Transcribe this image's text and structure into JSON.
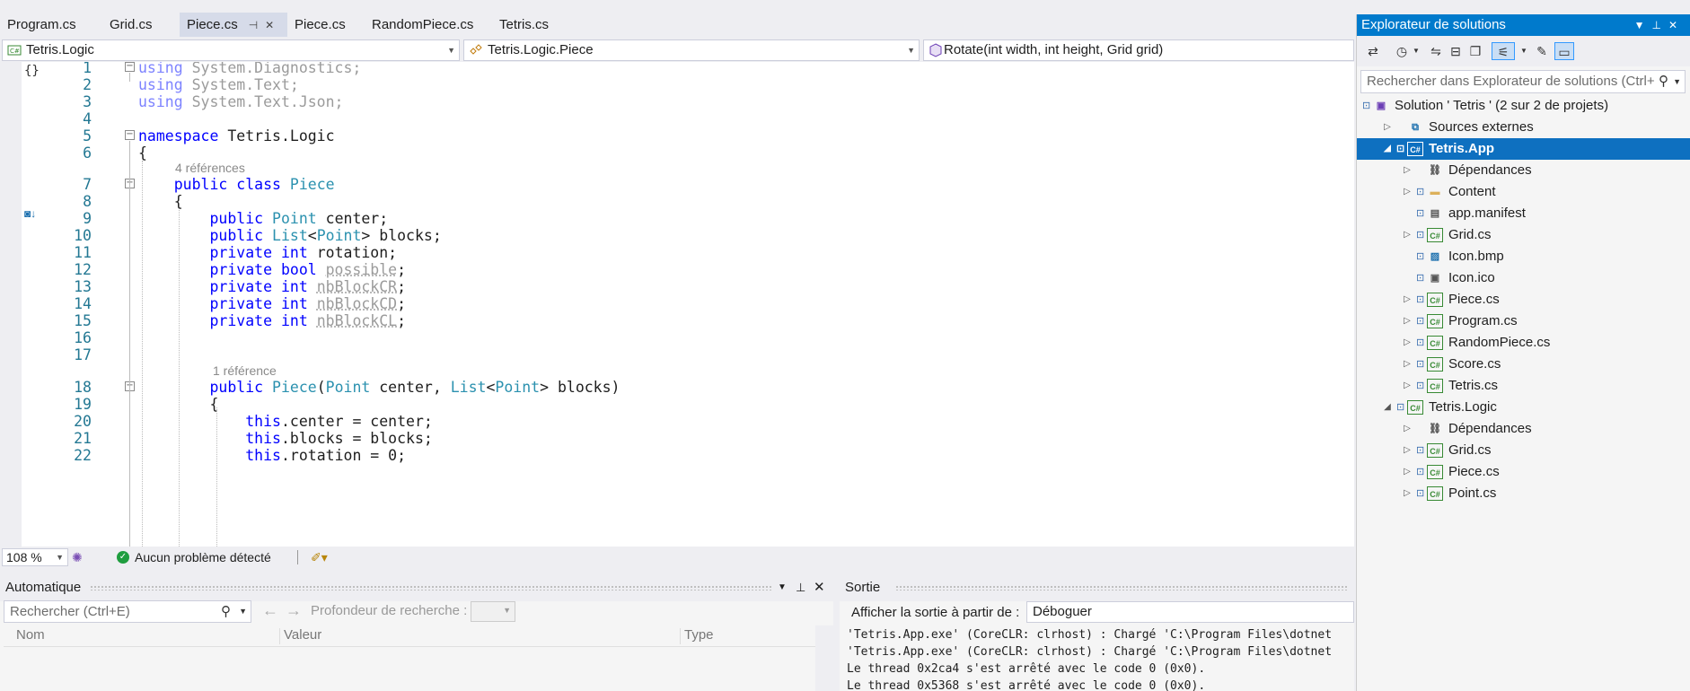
{
  "tabs": [
    {
      "label": "Program.cs",
      "active": false
    },
    {
      "label": "Grid.cs",
      "active": false
    },
    {
      "label": "Piece.cs",
      "active": true
    },
    {
      "label": "Piece.cs",
      "active": false
    },
    {
      "label": "RandomPiece.cs",
      "active": false
    },
    {
      "label": "Tetris.cs",
      "active": false
    }
  ],
  "navbar": {
    "project": "Tetris.Logic",
    "type": "Tetris.Logic.Piece",
    "member": "Rotate(int width, int height, Grid grid)"
  },
  "editor": {
    "lines": [
      {
        "n": "1",
        "tokens": [
          [
            "kw-dim",
            "using "
          ],
          [
            "dim",
            "System.Diagnostics;"
          ]
        ]
      },
      {
        "n": "2",
        "tokens": [
          [
            "kw-dim",
            "using "
          ],
          [
            "dim",
            "System.Text;"
          ]
        ]
      },
      {
        "n": "3",
        "tokens": [
          [
            "kw-dim",
            "using "
          ],
          [
            "dim",
            "System.Text.Json;"
          ]
        ]
      },
      {
        "n": "4",
        "tokens": []
      },
      {
        "n": "5",
        "tokens": [
          [
            "kw",
            "namespace "
          ],
          [
            "",
            "Tetris.Logic"
          ]
        ]
      },
      {
        "n": "6",
        "tokens": [
          [
            "",
            "{"
          ]
        ]
      },
      {
        "n": "7",
        "tokens": [
          [
            "",
            "    "
          ],
          [
            "kw",
            "public class "
          ],
          [
            "ty",
            "Piece"
          ]
        ]
      },
      {
        "n": "8",
        "tokens": [
          [
            "",
            "    {"
          ]
        ]
      },
      {
        "n": "9",
        "tokens": [
          [
            "",
            "        "
          ],
          [
            "kw",
            "public "
          ],
          [
            "ty",
            "Point"
          ],
          [
            "",
            " center;"
          ]
        ]
      },
      {
        "n": "10",
        "tokens": [
          [
            "",
            "        "
          ],
          [
            "kw",
            "public "
          ],
          [
            "ty",
            "List"
          ],
          [
            "",
            "<"
          ],
          [
            "ty",
            "Point"
          ],
          [
            "",
            "> blocks;"
          ]
        ]
      },
      {
        "n": "11",
        "tokens": [
          [
            "",
            "        "
          ],
          [
            "kw",
            "private int "
          ],
          [
            "",
            "rotation;"
          ]
        ]
      },
      {
        "n": "12",
        "tokens": [
          [
            "",
            "        "
          ],
          [
            "kw",
            "private bool "
          ],
          [
            "gru",
            "possible"
          ],
          [
            "",
            ";"
          ]
        ]
      },
      {
        "n": "13",
        "tokens": [
          [
            "",
            "        "
          ],
          [
            "kw",
            "private int "
          ],
          [
            "gru",
            "nbBlockCR"
          ],
          [
            "",
            ";"
          ]
        ]
      },
      {
        "n": "14",
        "tokens": [
          [
            "",
            "        "
          ],
          [
            "kw",
            "private int "
          ],
          [
            "gru",
            "nbBlockCD"
          ],
          [
            "",
            ";"
          ]
        ]
      },
      {
        "n": "15",
        "tokens": [
          [
            "",
            "        "
          ],
          [
            "kw",
            "private int "
          ],
          [
            "gru",
            "nbBlockCL"
          ],
          [
            "",
            ";"
          ]
        ]
      },
      {
        "n": "16",
        "tokens": []
      },
      {
        "n": "17",
        "tokens": []
      },
      {
        "n": "18",
        "tokens": [
          [
            "",
            "        "
          ],
          [
            "kw",
            "public "
          ],
          [
            "ty",
            "Piece"
          ],
          [
            "",
            "("
          ],
          [
            "ty",
            "Point"
          ],
          [
            "",
            " center, "
          ],
          [
            "ty",
            "List"
          ],
          [
            "",
            "<"
          ],
          [
            "ty",
            "Point"
          ],
          [
            "",
            "> blocks)"
          ]
        ]
      },
      {
        "n": "19",
        "tokens": [
          [
            "",
            "        {"
          ]
        ]
      },
      {
        "n": "20",
        "tokens": [
          [
            "",
            "            "
          ],
          [
            "kw",
            "this"
          ],
          [
            "",
            ".center = center;"
          ]
        ]
      },
      {
        "n": "21",
        "tokens": [
          [
            "",
            "            "
          ],
          [
            "kw",
            "this"
          ],
          [
            "",
            ".blocks = blocks;"
          ]
        ]
      },
      {
        "n": "22",
        "tokens": [
          [
            "",
            "            "
          ],
          [
            "kw",
            "this"
          ],
          [
            "",
            ".rotation = 0;"
          ]
        ]
      }
    ],
    "refs": [
      {
        "text": "4 références"
      },
      {
        "text": "1 référence"
      }
    ]
  },
  "status": {
    "zoom": "108 %",
    "problems": "Aucun problème détecté"
  },
  "auto_panel": {
    "title": "Automatique",
    "search_placeholder": "Rechercher (Ctrl+E)",
    "depth_label": "Profondeur de recherche :",
    "columns": [
      "Nom",
      "Valeur",
      "Type"
    ]
  },
  "output_panel": {
    "title": "Sortie",
    "source_label": "Afficher la sortie à partir de :",
    "source_value": "Déboguer",
    "lines": [
      "'Tetris.App.exe' (CoreCLR: clrhost) : Chargé 'C:\\Program Files\\dotnet",
      "'Tetris.App.exe' (CoreCLR: clrhost) : Chargé 'C:\\Program Files\\dotnet",
      "Le thread 0x2ca4 s'est arrêté avec le code 0 (0x0).",
      "Le thread 0x5368 s'est arrêté avec le code 0 (0x0)."
    ]
  },
  "solution_explorer": {
    "title": "Explorateur de solutions",
    "search_placeholder": "Rechercher dans Explorateur de solutions (Ctrl+",
    "items": [
      {
        "label": "Solution ' Tetris ' (2 sur 2 de projets)",
        "level": 0,
        "arrow": "",
        "icon": "solution-icon",
        "lock": true
      },
      {
        "label": "Sources externes",
        "level": 1,
        "arrow": "right",
        "icon": "external-sources-icon",
        "lock": false
      },
      {
        "label": "Tetris.App",
        "level": 1,
        "arrow": "down",
        "icon": "csharp-project-icon",
        "lock": true,
        "selected": true
      },
      {
        "label": "Dépendances",
        "level": 2,
        "arrow": "right",
        "icon": "dependencies-icon",
        "lock": false
      },
      {
        "label": "Content",
        "level": 2,
        "arrow": "right",
        "icon": "folder-icon",
        "lock": true
      },
      {
        "label": "app.manifest",
        "level": 2,
        "arrow": "",
        "icon": "manifest-icon",
        "lock": true
      },
      {
        "label": "Grid.cs",
        "level": 2,
        "arrow": "right",
        "icon": "csharp-file-icon",
        "lock": true
      },
      {
        "label": "Icon.bmp",
        "level": 2,
        "arrow": "",
        "icon": "image-icon",
        "lock": true
      },
      {
        "label": "Icon.ico",
        "level": 2,
        "arrow": "",
        "icon": "ico-file-icon",
        "lock": true
      },
      {
        "label": "Piece.cs",
        "level": 2,
        "arrow": "right",
        "icon": "csharp-file-icon",
        "lock": true
      },
      {
        "label": "Program.cs",
        "level": 2,
        "arrow": "right",
        "icon": "csharp-file-icon",
        "lock": true
      },
      {
        "label": "RandomPiece.cs",
        "level": 2,
        "arrow": "right",
        "icon": "csharp-file-icon",
        "lock": true
      },
      {
        "label": "Score.cs",
        "level": 2,
        "arrow": "right",
        "icon": "csharp-file-icon",
        "lock": true
      },
      {
        "label": "Tetris.cs",
        "level": 2,
        "arrow": "right",
        "icon": "csharp-file-icon",
        "lock": true
      },
      {
        "label": "Tetris.Logic",
        "level": 1,
        "arrow": "down",
        "icon": "csharp-project-icon",
        "lock": true
      },
      {
        "label": "Dépendances",
        "level": 2,
        "arrow": "right",
        "icon": "dependencies-icon",
        "lock": false
      },
      {
        "label": "Grid.cs",
        "level": 2,
        "arrow": "right",
        "icon": "csharp-file-icon",
        "lock": true
      },
      {
        "label": "Piece.cs",
        "level": 2,
        "arrow": "right",
        "icon": "csharp-file-icon",
        "lock": true
      },
      {
        "label": "Point.cs",
        "level": 2,
        "arrow": "right",
        "icon": "csharp-file-icon",
        "lock": true
      }
    ]
  },
  "colors": {
    "accent": "#007acc",
    "selection": "#0e70c0",
    "keyword": "#0000ff",
    "type": "#2b91af",
    "line_number": "#237893"
  }
}
